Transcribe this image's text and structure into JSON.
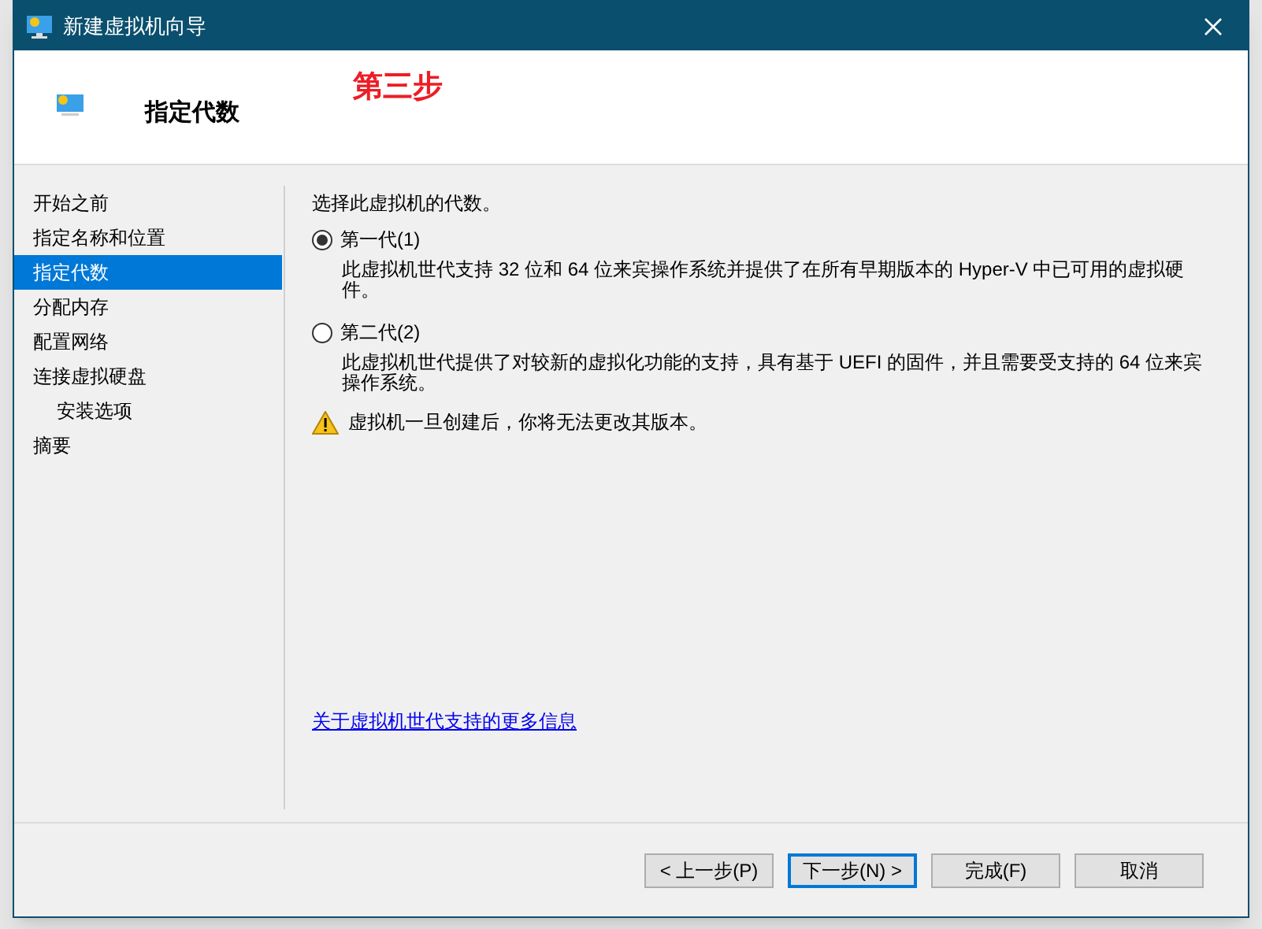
{
  "window": {
    "title": "新建虚拟机向导"
  },
  "header": {
    "title": "指定代数",
    "annotation": "第三步"
  },
  "sidebar": {
    "items": [
      {
        "label": "开始之前",
        "selected": false
      },
      {
        "label": "指定名称和位置",
        "selected": false
      },
      {
        "label": "指定代数",
        "selected": true
      },
      {
        "label": "分配内存",
        "selected": false
      },
      {
        "label": "配置网络",
        "selected": false
      },
      {
        "label": "连接虚拟硬盘",
        "selected": false,
        "children": [
          {
            "label": "安装选项",
            "selected": false
          }
        ]
      },
      {
        "label": "摘要",
        "selected": false
      }
    ]
  },
  "content": {
    "prompt": "选择此虚拟机的代数。",
    "options": [
      {
        "label": "第一代(1)",
        "selected": true,
        "description": "此虚拟机世代支持 32 位和 64 位来宾操作系统并提供了在所有早期版本的 Hyper-V 中已可用的虚拟硬件。"
      },
      {
        "label": "第二代(2)",
        "selected": false,
        "description": "此虚拟机世代提供了对较新的虚拟化功能的支持，具有基于 UEFI 的固件，并且需要受支持的 64 位来宾操作系统。"
      }
    ],
    "warning": "虚拟机一旦创建后，你将无法更改其版本。",
    "link": "关于虚拟机世代支持的更多信息"
  },
  "buttons": [
    {
      "label": "< 上一步(P)",
      "default": false
    },
    {
      "label": "下一步(N) >",
      "default": true
    },
    {
      "label": "完成(F)",
      "default": false
    },
    {
      "label": "取消",
      "default": false
    }
  ]
}
